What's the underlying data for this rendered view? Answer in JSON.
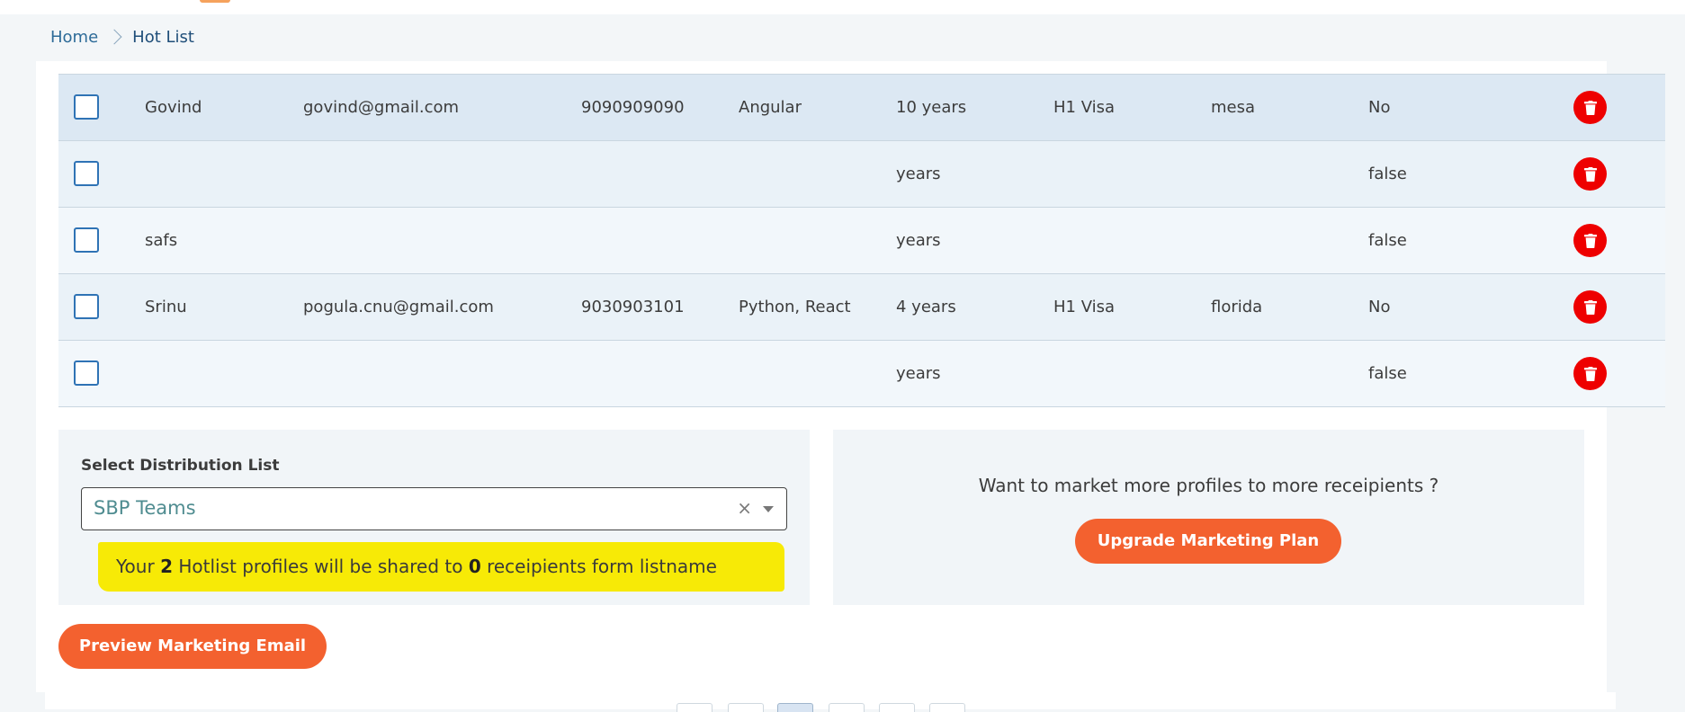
{
  "breadcrumb": {
    "home": "Home",
    "current": "Hot List"
  },
  "table": {
    "rows": [
      {
        "name": "Govind",
        "email": "govind@gmail.com",
        "phone": "9090909090",
        "skills": "Angular",
        "experience": "10 years",
        "visa": "H1 Visa",
        "location": "mesa",
        "relocate": "No"
      },
      {
        "name": "",
        "email": "",
        "phone": "",
        "skills": "",
        "experience": "years",
        "visa": "",
        "location": "",
        "relocate": "false"
      },
      {
        "name": "safs",
        "email": "",
        "phone": "",
        "skills": "",
        "experience": "years",
        "visa": "",
        "location": "",
        "relocate": "false"
      },
      {
        "name": "Srinu",
        "email": "pogula.cnu@gmail.com",
        "phone": "9030903101",
        "skills": "Python, React",
        "experience": "4 years",
        "visa": "H1 Visa",
        "location": "florida",
        "relocate": "No"
      },
      {
        "name": "",
        "email": "",
        "phone": "",
        "skills": "",
        "experience": "years",
        "visa": "",
        "location": "",
        "relocate": "false"
      }
    ]
  },
  "distribution": {
    "label": "Select Distribution List",
    "selected": "SBP Teams",
    "clear_symbol": "×",
    "share_prefix": "Your ",
    "profile_count": "2",
    "share_middle": " Hotlist profiles will be shared to ",
    "recipient_count": "0",
    "share_suffix": " receipients form listname"
  },
  "upgrade": {
    "prompt": "Want to market more profiles to more receipients ?",
    "button": "Upgrade Marketing Plan"
  },
  "preview_button": "Preview Marketing Email",
  "colors": {
    "accent": "#f3612f",
    "delete": "#ee0000",
    "highlight": "#f7ea06",
    "link": "#2d6b98"
  },
  "icons": {
    "delete": "trash-icon",
    "breadcrumb_separator": "chevron-right-icon",
    "dropdown": "caret-down-icon"
  }
}
